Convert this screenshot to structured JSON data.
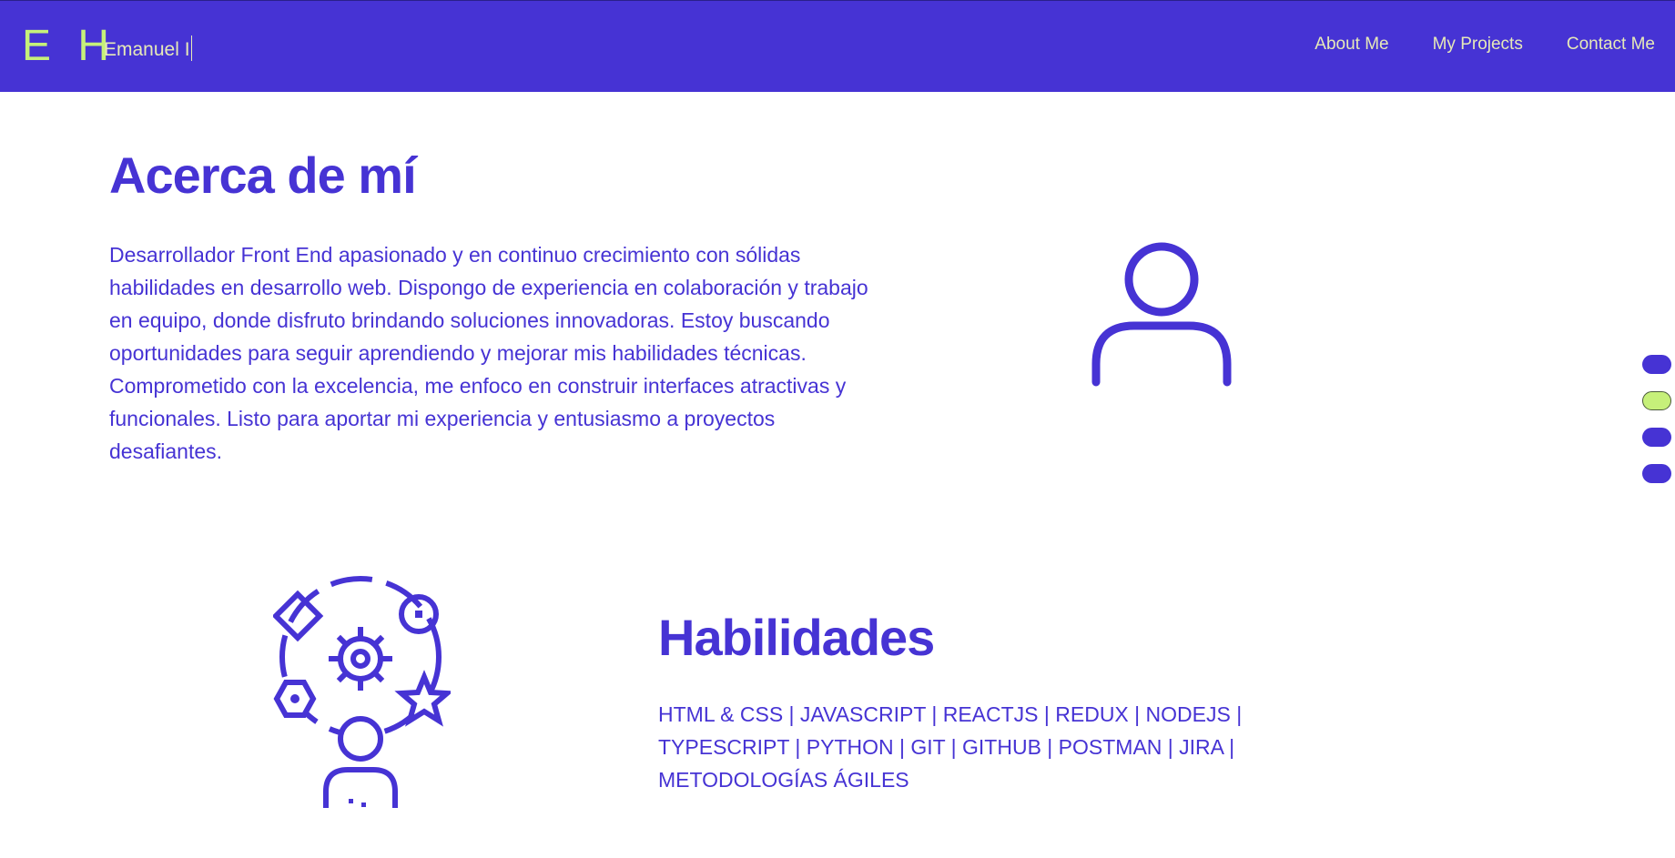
{
  "header": {
    "logo": "E H",
    "typed_name": "Emanuel I",
    "nav": [
      {
        "label": "About Me"
      },
      {
        "label": "My Projects"
      },
      {
        "label": "Contact Me"
      }
    ]
  },
  "about": {
    "title": "Acerca de mí",
    "text": "Desarrollador Front End apasionado y en continuo crecimiento con sólidas habilidades en desarrollo web. Dispongo de experiencia en colaboración y trabajo en equipo, donde disfruto brindando soluciones innovadoras. Estoy buscando oportunidades para seguir aprendiendo y mejorar mis habilidades técnicas. Comprometido con la excelencia, me enfoco en construir interfaces atractivas y funcionales. Listo para aportar mi experiencia y entusiasmo a proyectos desafiantes.",
    "icon": "user-icon"
  },
  "skills": {
    "title": "Habilidades",
    "text": "HTML & CSS | JAVASCRIPT | REACTJS | REDUX | NODEJS | TYPESCRIPT | PYTHON | GIT | GITHUB | POSTMAN | JIRA | METODOLOGÍAS ÁGILES",
    "icon": "skills-icon"
  },
  "section_dots": {
    "count": 4,
    "active_index": 1
  },
  "colors": {
    "primary": "#4633d4",
    "accent": "#c6f07a",
    "nav_text": "#e6e9b8",
    "background": "#ffffff"
  }
}
